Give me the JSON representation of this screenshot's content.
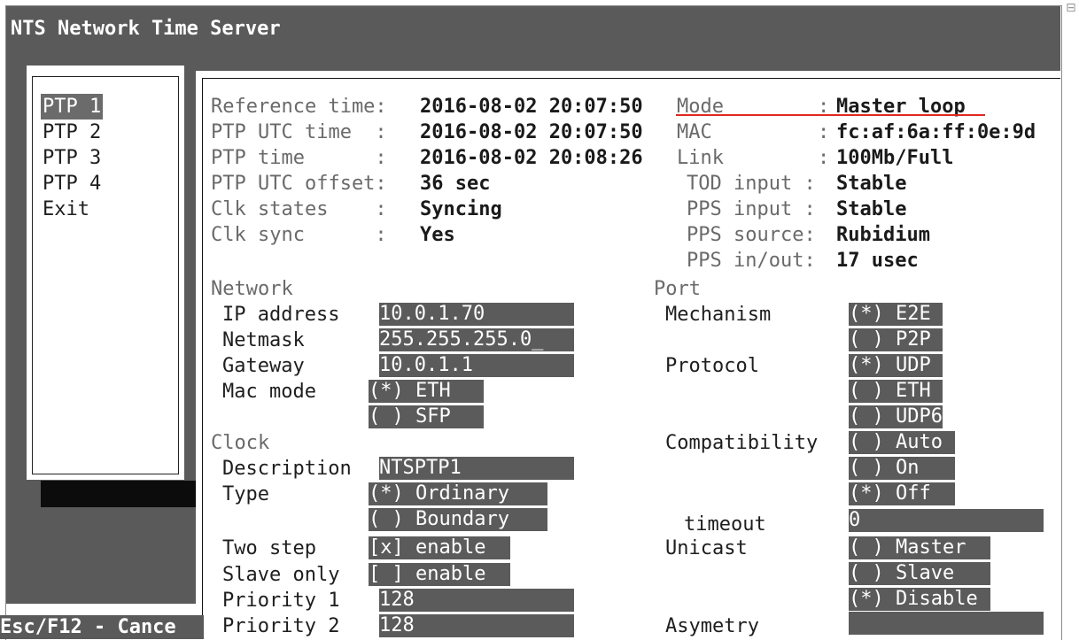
{
  "window": {
    "title": "NTS Network Time Server",
    "window_button": "⊟"
  },
  "menu": {
    "items": [
      "PTP 1",
      "PTP 2",
      "PTP 3",
      "PTP 4",
      "Exit"
    ],
    "selected": "PTP 1"
  },
  "status": {
    "left": {
      "labels": [
        "Reference time:",
        "PTP UTC time  :",
        "PTP time      :",
        "PTP UTC offset:",
        "Clk states    :",
        "Clk sync      :"
      ],
      "values": [
        "2016-08-02 20:07:50",
        "2016-08-02 20:07:50",
        "2016-08-02 20:08:26",
        "36 sec",
        "Syncing",
        "Yes"
      ]
    },
    "right": {
      "labels": [
        "Mode        :",
        "MAC         :",
        "Link        :",
        "TOD input :",
        "PPS input :",
        "PPS source:",
        "PPS in/out:"
      ],
      "values": [
        "Master loop",
        "fc:af:6a:ff:0e:9d",
        "100Mb/Full",
        "Stable",
        "Stable",
        "Rubidium",
        "17 usec"
      ]
    }
  },
  "network": {
    "heading": "Network",
    "ip_label": "IP address",
    "ip_value": "10.0.1.70",
    "netmask_label": "Netmask",
    "netmask_value": "255.255.255.0_",
    "gateway_label": "Gateway",
    "gateway_value": "10.0.1.1",
    "mac_mode_label": "Mac mode",
    "mac_mode_options": [
      "(*) ETH",
      "( ) SFP"
    ]
  },
  "clock": {
    "heading": "Clock",
    "description_label": "Description",
    "description_value": "NTSPTP1",
    "type_label": "Type",
    "type_options": [
      "(*) Ordinary",
      "( ) Boundary"
    ],
    "two_step_label": "Two step",
    "two_step_value": "[x] enable",
    "slave_only_label": "Slave only",
    "slave_only_value": "[ ] enable",
    "priority1_label": "Priority 1",
    "priority1_value": "128",
    "priority2_label": "Priority 2",
    "priority2_value": "128"
  },
  "port": {
    "heading": "Port",
    "mechanism_label": "Mechanism",
    "mechanism_options": [
      "(*) E2E",
      "( ) P2P"
    ],
    "protocol_label": "Protocol",
    "protocol_options": [
      "(*) UDP",
      "( ) ETH",
      "( ) UDP6"
    ],
    "compatibility_label": "Compatibility",
    "compatibility_options": [
      "( ) Auto",
      "( ) On",
      "(*) Off"
    ],
    "timeout_label": "timeout",
    "timeout_value": "0",
    "unicast_label": "Unicast",
    "unicast_options": [
      "( ) Master",
      "( ) Slave",
      "(*) Disable"
    ],
    "asymetry_label": "Asymetry",
    "asymetry_value": ""
  },
  "footer": {
    "hint": "Esc/F12 - Cance"
  },
  "colors": {
    "chrome_gray": "#5a5a5a",
    "field_gray": "#5b5b5b",
    "mode_underline": "#e0281e"
  }
}
